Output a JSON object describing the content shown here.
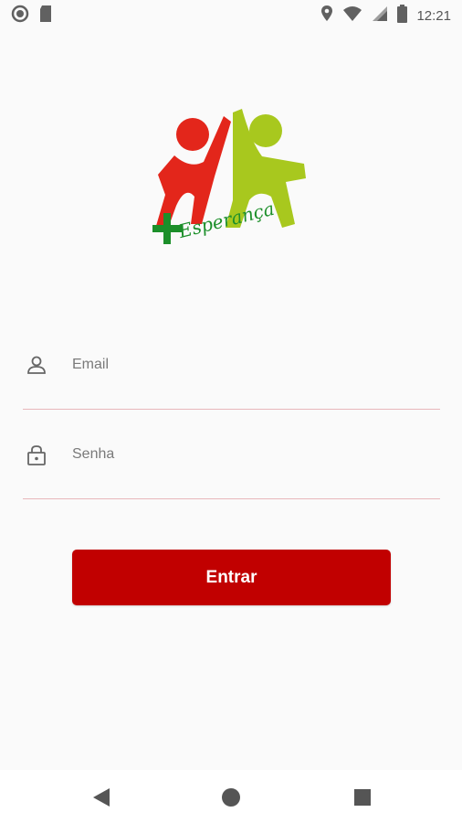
{
  "status_bar": {
    "time": "12:21",
    "left_icons": [
      "circle-notification-icon",
      "sd-card-icon"
    ],
    "right_icons": [
      "location-icon",
      "wifi-icon",
      "signal-icon",
      "battery-icon"
    ]
  },
  "logo": {
    "text": "Esperança",
    "colors": {
      "red": "#e3261b",
      "green": "#a8c81e",
      "text_green": "#1c8f2a",
      "plus": "#1c8f2a"
    }
  },
  "form": {
    "email": {
      "placeholder": "Email",
      "value": "",
      "icon": "person-icon"
    },
    "password": {
      "placeholder": "Senha",
      "value": "",
      "icon": "lock-icon"
    }
  },
  "login_button": {
    "label": "Entrar",
    "color": "#c10000"
  },
  "nav_bar": {
    "buttons": [
      "back-icon",
      "home-icon",
      "recents-icon"
    ]
  }
}
